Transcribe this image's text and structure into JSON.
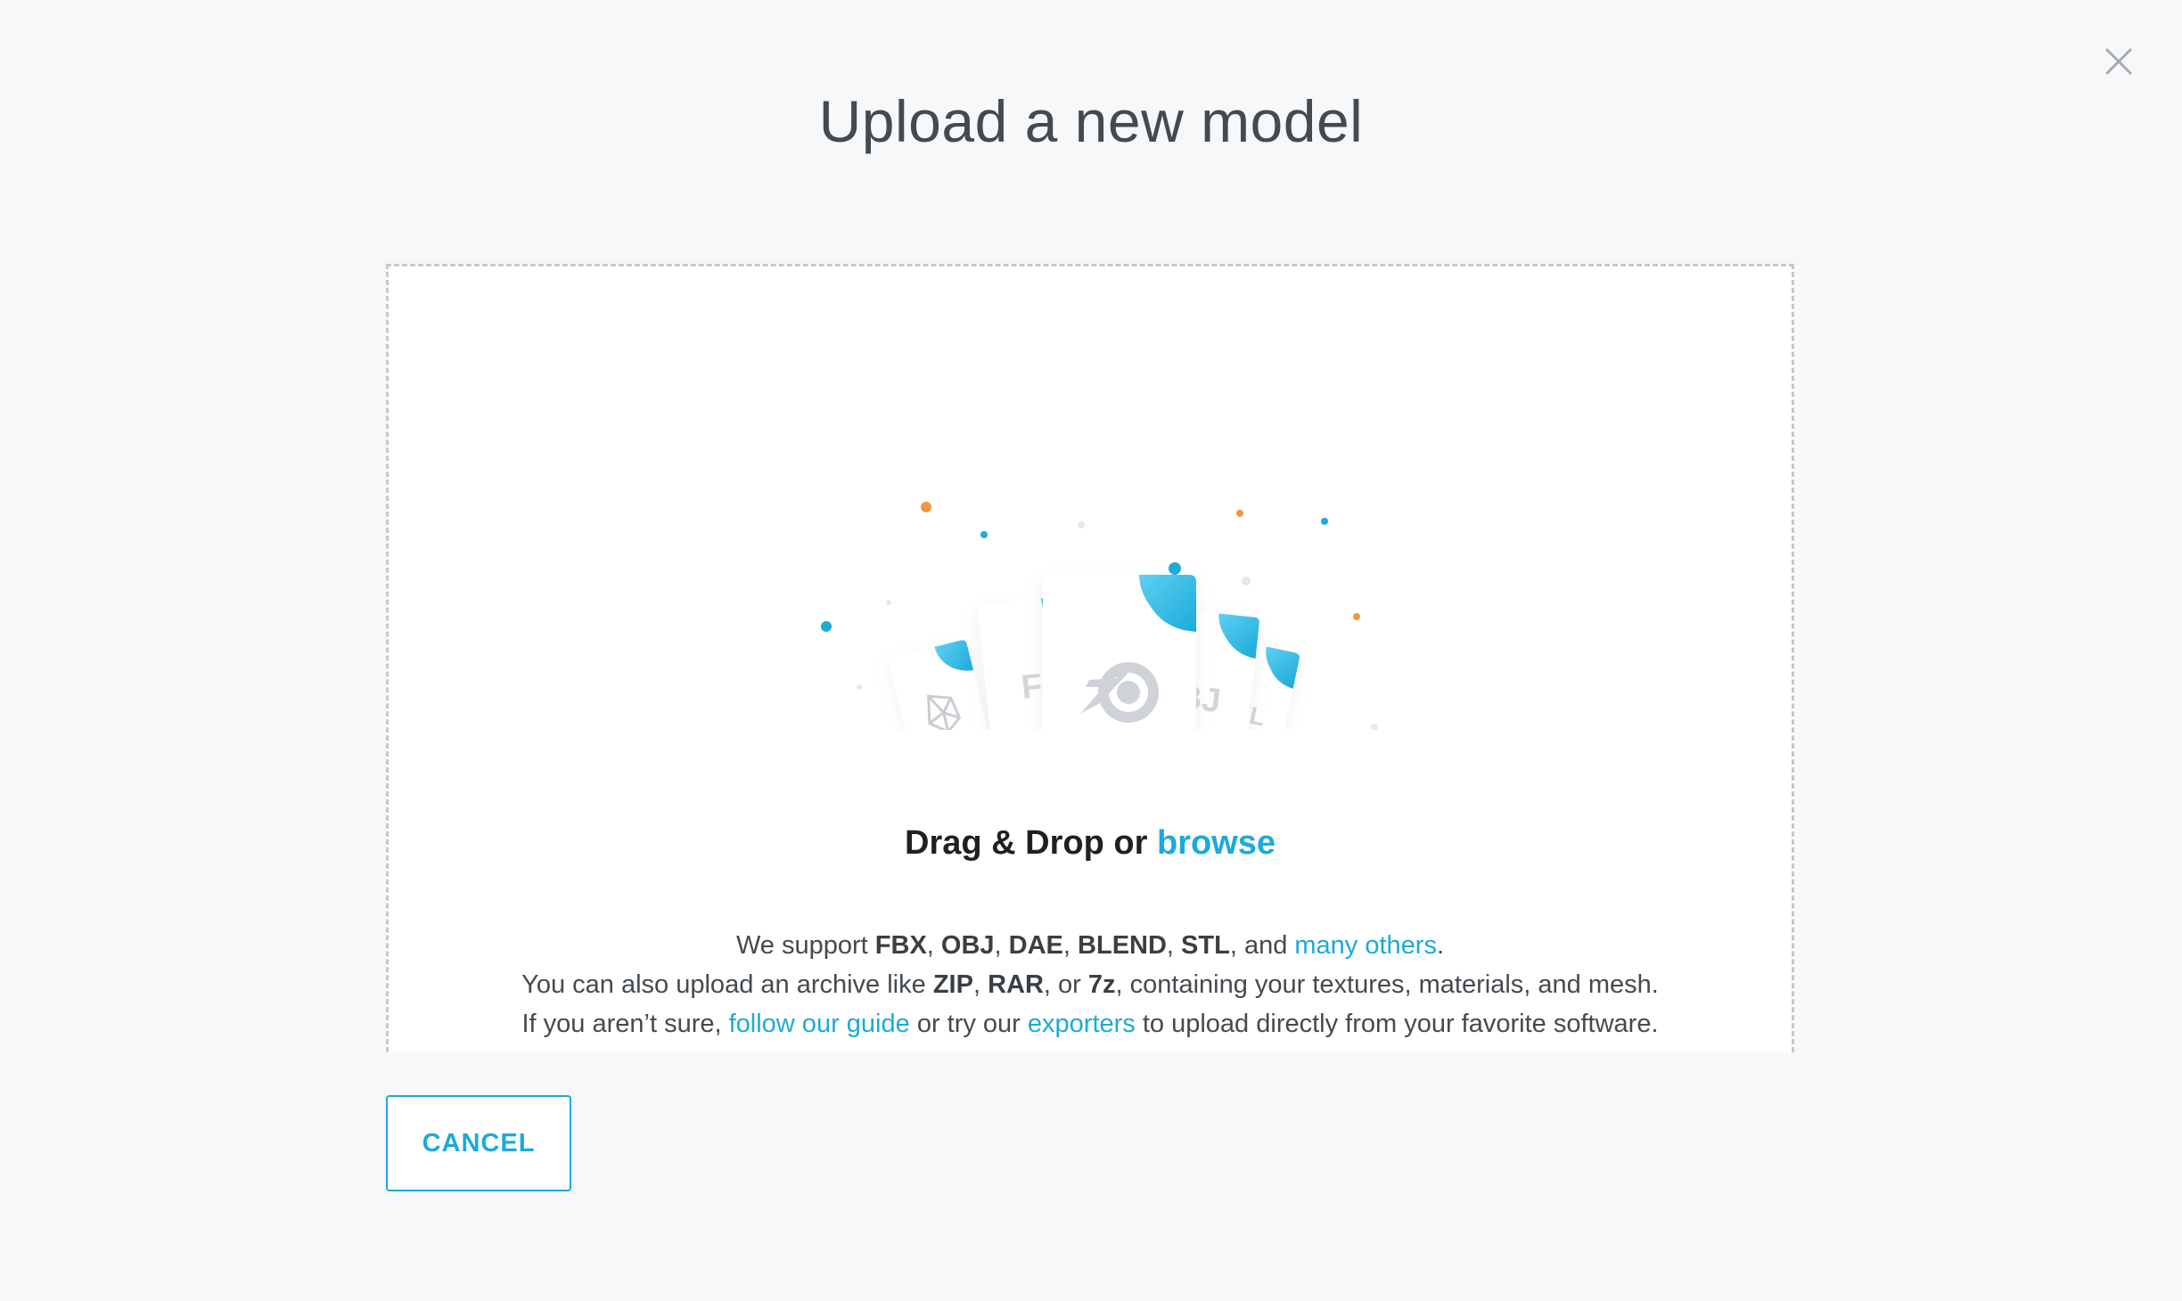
{
  "dialog": {
    "title": "Upload a new model",
    "close_icon": "close-icon"
  },
  "dropzone": {
    "drag_drop_text": "Drag & Drop or",
    "browse_link": "browse",
    "illustration": {
      "file_labels": [
        "FBX",
        "OBJ",
        "STL"
      ],
      "icons": [
        "sketchfab-logo-icon",
        "blender-logo-icon"
      ]
    },
    "info": {
      "line1": {
        "prefix": "We support",
        "formats": [
          "FBX",
          "OBJ",
          "DAE",
          "BLEND",
          "STL"
        ],
        "sep": ",",
        "and": ", and",
        "link": "many others",
        "suffix": "."
      },
      "line2": {
        "prefix": "You can also upload an archive like",
        "formats": [
          "ZIP",
          "RAR",
          "7z"
        ],
        "sep": ",",
        "or": ", or",
        "suffix": ", containing your textures, materials, and mesh."
      },
      "line3": {
        "prefix": "If you aren’t sure,",
        "link1": "follow our guide",
        "middle": "or try our",
        "link2": "exporters",
        "suffix": "to upload directly from your favorite software."
      }
    }
  },
  "footer": {
    "cancel_label": "CANCEL"
  },
  "colors": {
    "accent": "#1caad9",
    "orange_dot": "#f5943d",
    "background": "#f7f8fa"
  }
}
